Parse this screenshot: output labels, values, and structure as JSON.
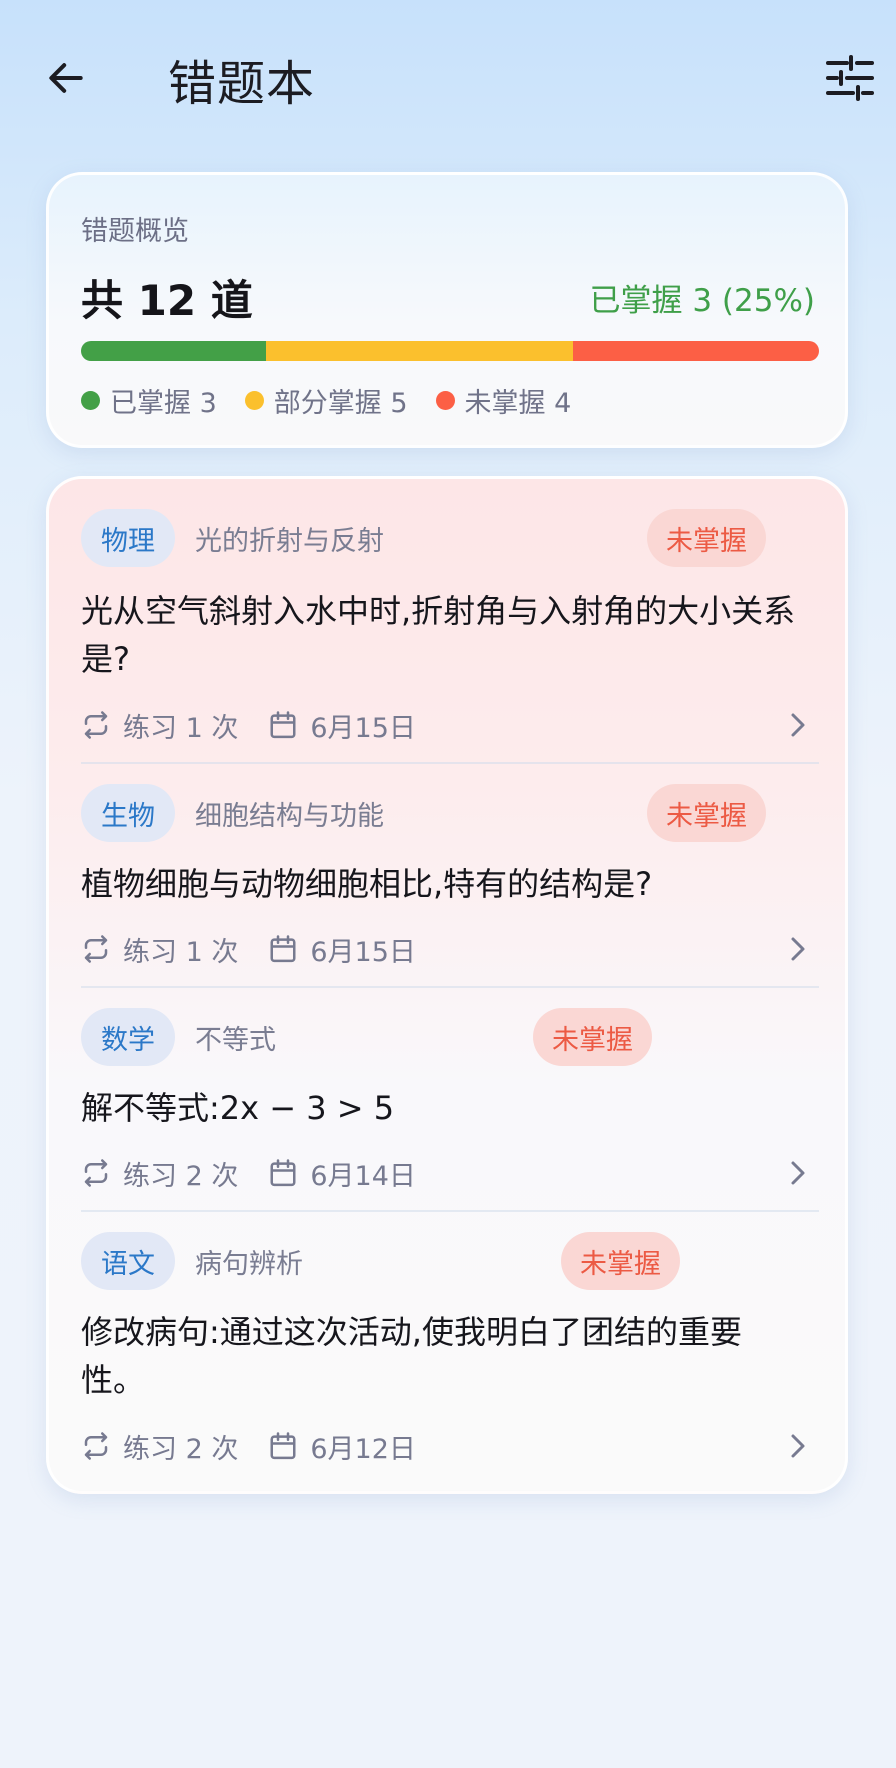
{
  "header": {
    "title": "错题本"
  },
  "overview": {
    "label": "错题概览",
    "total_text": "共 12 道",
    "mastered_text": "已掌握 3 (25%)",
    "counts": {
      "mastered": 3,
      "partial": 5,
      "not_mastered": 4,
      "total": 12
    },
    "legend": {
      "mastered": "已掌握 3",
      "partial": "部分掌握 5",
      "not_mastered": "未掌握 4"
    },
    "colors": {
      "mastered": "#43a047",
      "partial": "#fbc02d",
      "not_mastered": "#fc5f45"
    }
  },
  "items": [
    {
      "subject": "物理",
      "topic": "光的折射与反射",
      "status": "未掌握",
      "question": "光从空气斜射入水中时,折射角与入射角的大小关系是?",
      "practice": "练习 1 次",
      "date": "6月15日"
    },
    {
      "subject": "生物",
      "topic": "细胞结构与功能",
      "status": "未掌握",
      "question": "植物细胞与动物细胞相比,特有的结构是?",
      "practice": "练习 1 次",
      "date": "6月15日"
    },
    {
      "subject": "数学",
      "topic": "不等式",
      "status": "未掌握",
      "question": "解不等式:2x − 3 > 5",
      "practice": "练习 2 次",
      "date": "6月14日"
    },
    {
      "subject": "语文",
      "topic": "病句辨析",
      "status": "未掌握",
      "question": "修改病句:通过这次活动,使我明白了团结的重要性。",
      "practice": "练习 2 次",
      "date": "6月12日"
    }
  ]
}
